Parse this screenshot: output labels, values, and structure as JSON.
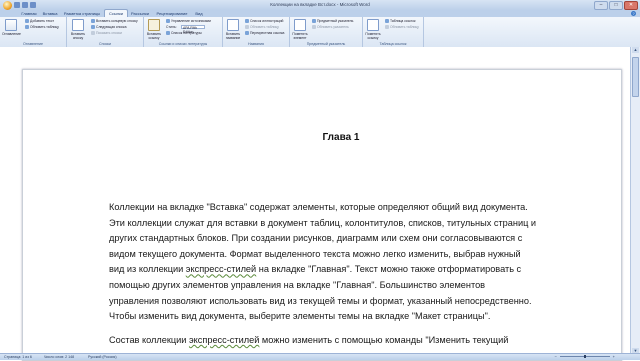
{
  "window": {
    "title": "Коллекции на вкладке Вст.docx - Microsoft Word",
    "controls": [
      "–",
      "□",
      "✕"
    ]
  },
  "tabs": [
    {
      "label": "Главная",
      "active": false
    },
    {
      "label": "Вставка",
      "active": false
    },
    {
      "label": "Разметка страницы",
      "active": false
    },
    {
      "label": "Ссылки",
      "active": true
    },
    {
      "label": "Рассылки",
      "active": false
    },
    {
      "label": "Рецензирование",
      "active": false
    },
    {
      "label": "Вид",
      "active": false
    }
  ],
  "ribbon": {
    "toc_group": {
      "label": "Оглавление",
      "big": "Оглавление",
      "add_text": "Добавить текст",
      "update_table": "Обновить таблицу"
    },
    "footnotes_group": {
      "label": "Сноски",
      "big": "Вставить сноску",
      "insert_endnote": "Вставить концевую сноску",
      "next_footnote": "Следующая сноска",
      "show_notes": "Показать сноски"
    },
    "citations_group": {
      "label": "Ссылки и списки литературы",
      "big": "Вставить ссылку",
      "manage_sources": "Управление источниками",
      "style_label": "Стиль:",
      "style_value": "APA Fifth Edition",
      "bibliography": "Список литературы"
    },
    "captions_group": {
      "label": "Названия",
      "big": "Вставить название",
      "table_of_figures": "Список иллюстраций",
      "update_table": "Обновить таблицу",
      "cross_reference": "Перекрестная ссылка"
    },
    "index_group": {
      "label": "Предметный указатель",
      "big": "Пометить элемент",
      "insert_index": "Предметный указатель",
      "update_index": "Обновить указатель"
    },
    "authorities_group": {
      "label": "Таблица ссылок",
      "big": "Пометить ссылку",
      "insert_table": "Таблица ссылок",
      "update_table": "Обновить таблицу"
    }
  },
  "document": {
    "heading": "Глава 1",
    "paragraph1": [
      "Коллекции на вкладке \"Вставка\" содержат элементы, которые определяют общий вид документа.",
      "Эти коллекции служат для вставки в документ таблиц, колонтитулов, списков, титульных страниц и",
      "других стандартных блоков. При создании рисунков, диаграмм или схем они согласовываются с",
      "видом текущего документа. Формат выделенного текста можно легко изменить, выбрав нужный",
      "вид из коллекции экспресс-стилей на вкладке \"Главная\". Текст можно также отформатировать с",
      "помощью других элементов управления на вкладке \"Главная\". Большинство элементов",
      "управления позволяют использовать вид из текущей темы и формат, указанный непосредственно.",
      "Чтобы изменить вид документа, выберите элементы темы на вкладке \"Макет страницы\"."
    ],
    "paragraph2": [
      "Состав коллекции экспресс-стилей можно изменить с помощью команды \"Изменить текущий"
    ]
  },
  "status": {
    "page": "Страница: 1 из 6",
    "words": "Число слов: 2 148",
    "language": "Русский (Россия)"
  },
  "colors": {
    "accent": "#3a78c8",
    "ribbon_bg": "#dbe6f4",
    "title_bg": "#bcd0ea"
  }
}
